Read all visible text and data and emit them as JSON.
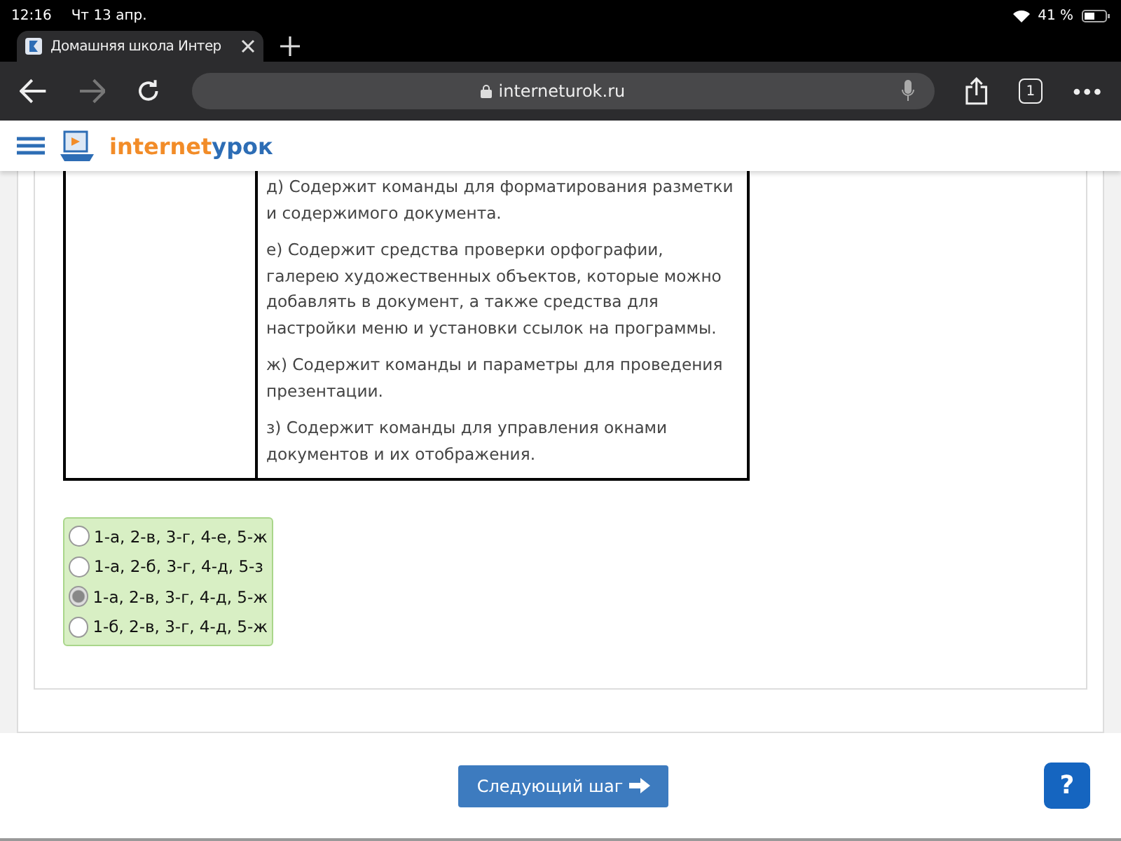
{
  "status_bar": {
    "time": "12:16",
    "date": "Чт 13 апр.",
    "battery": "41 %"
  },
  "tab": {
    "title": "Домашняя школа Интер"
  },
  "address_bar": {
    "url": "interneturok.ru",
    "tab_count": "1"
  },
  "site": {
    "logo_part1": "internet",
    "logo_part2": "урок"
  },
  "table": {
    "right_items": [
      "д) Содержит команды для форматирования разметки и содержимого документа.",
      "е) Содержит средства проверки орфографии, галерею художественных объектов, которые можно добавлять в документ, а также средства для настройки меню и установки ссылок на программы.",
      "ж) Содержит команды и параметры для проведения презентации.",
      "з) Содержит команды для управления окнами документов и их отображения."
    ]
  },
  "options": [
    {
      "label": "1-а, 2-в, 3-г, 4-е, 5-ж",
      "selected": false
    },
    {
      "label": "1-а, 2-б, 3-г, 4-д, 5-з",
      "selected": false
    },
    {
      "label": "1-а, 2-в, 3-г, 4-д, 5-ж",
      "selected": true
    },
    {
      "label": "1-б, 2-в, 3-г, 4-д, 5-ж",
      "selected": false
    }
  ],
  "next_button": "Следующий шаг",
  "help_button": "?"
}
